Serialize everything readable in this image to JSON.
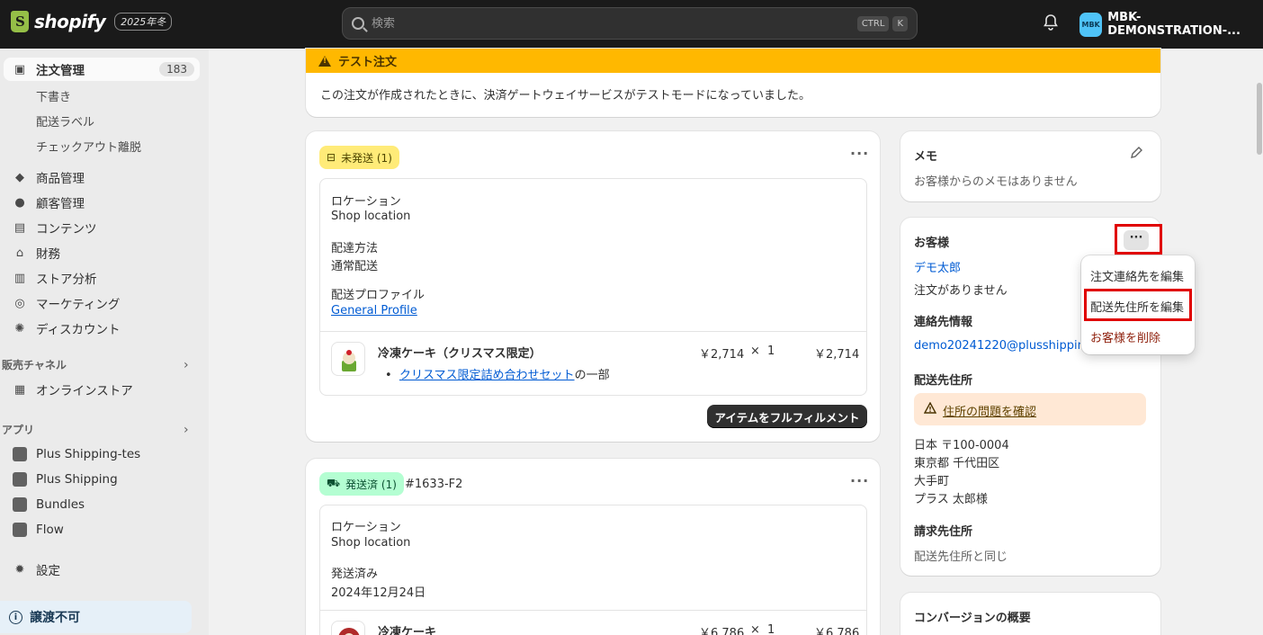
{
  "topbar": {
    "logo_text": "shopify",
    "edition_badge": "2025年冬",
    "search_placeholder": "検索",
    "shortcut_ctrl": "CTRL",
    "shortcut_key": "K",
    "store_avatar": "MBK",
    "store_name": "MBK-DEMONSTRATION-..."
  },
  "sidebar": {
    "orders_label": "注文管理",
    "orders_count": "183",
    "orders_sub": [
      "下書き",
      "配送ラベル",
      "チェックアウト離脱"
    ],
    "items": [
      "商品管理",
      "顧客管理",
      "コンテンツ",
      "財務",
      "ストア分析",
      "マーケティング",
      "ディスカウント"
    ],
    "sales_channels_label": "販売チャネル",
    "online_store": "オンラインストア",
    "apps_label": "アプリ",
    "apps": [
      "Plus Shipping-tes",
      "Plus Shipping",
      "Bundles",
      "Flow"
    ],
    "settings": "設定",
    "footer": "譲渡不可"
  },
  "test_banner": {
    "title": "テスト注文",
    "message": "この注文が作成されたときに、決済ゲートウェイサービスがテストモードになっていました。"
  },
  "unfulfilled": {
    "badge": "未発送 (1)",
    "location_label": "ロケーション",
    "location_value": "Shop location",
    "method_label": "配達方法",
    "method_value": "通常配送",
    "profile_label": "配送プロファイル",
    "profile_value": "General Profile",
    "item_name": "冷凍ケーキ（クリスマス限定）",
    "item_bundle_link": "クリスマス限定詰め合わせセット",
    "item_bundle_suffix": "の一部",
    "item_price": "￥2,714",
    "item_times": "×",
    "item_qty": "1",
    "item_total": "￥2,714",
    "fulfill_button": "アイテムをフルフィルメント"
  },
  "fulfilled": {
    "badge": "発送済 (1)",
    "order_ref": "#1633-F2",
    "location_label": "ロケーション",
    "location_value": "Shop location",
    "shipped_label": "発送済み",
    "shipped_date": "2024年12月24日",
    "item_name": "冷凍ケーキ",
    "item_price": "￥6,786",
    "item_times": "×",
    "item_qty": "1",
    "item_total": "￥6,786"
  },
  "memo": {
    "title": "メモ",
    "text": "お客様からのメモはありません"
  },
  "customer": {
    "title": "お客様",
    "name": "デモ太郎",
    "orders": "注文がありません",
    "contact_title": "連絡先情報",
    "email": "demo20241220@plusshipping",
    "shipping_title": "配送先住所",
    "address_warning": "住所の問題を確認",
    "address_lines": [
      "日本 〒100-0004",
      "東京都 千代田区",
      "大手町",
      "プラス 太郎様"
    ],
    "billing_title": "請求先住所",
    "billing_text": "配送先住所と同じ"
  },
  "menu": {
    "edit_contact": "注文連絡先を編集",
    "edit_shipping": "配送先住所を編集",
    "delete_customer": "お客様を削除"
  },
  "conversion": {
    "title": "コンバージョンの概要"
  },
  "colors": {
    "highlight": "#e00000",
    "banner": "#ffb800",
    "link": "#005bd3",
    "danger": "#8e1f0b"
  }
}
